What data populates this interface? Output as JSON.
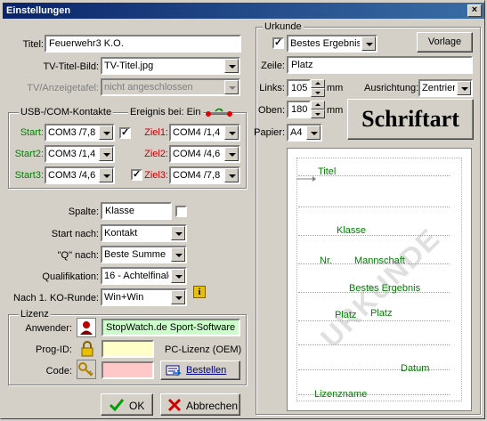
{
  "window": {
    "title": "Einstellungen",
    "close": "×"
  },
  "left": {
    "titel_label": "Titel:",
    "titel_value": "Feuerwehr3 K.O.",
    "tvbild_label": "TV-Titel-Bild:",
    "tvbild_value": "TV-Titel.jpg",
    "tvanz_label": "TV/Anzeigetafel:",
    "tvanz_value": "nicht angeschlossen",
    "usb_group": "USB-/COM-Kontakte",
    "ereignis_label": "Ereignis bei: Ein",
    "start_label": "Start:",
    "start_value": "COM3 /7,8",
    "start2_label": "Start2:",
    "start2_value": "COM3 /1,4",
    "start3_label": "Start3:",
    "start3_value": "COM3 /4,6",
    "ziel1_label": "Ziel1:",
    "ziel1_value": "COM4 /1,4",
    "ziel2_label": "Ziel2:",
    "ziel2_value": "COM4 /4,6",
    "ziel3_label": "Ziel3:",
    "ziel3_value": "COM4 /7,8",
    "check_mark": "✓",
    "spalte_label": "Spalte:",
    "spalte_value": "Klasse",
    "startnach_label": "Start nach:",
    "startnach_value": "Kontakt",
    "qnach_label": "\"Q\" nach:",
    "qnach_value": "Beste Summe",
    "quali_label": "Qualifikation:",
    "quali_value": "16 - Achtelfinale",
    "ko_label": "Nach 1. KO-Runde:",
    "ko_value": "Win+Win",
    "info_icon_text": "i",
    "lizenz_group": "Lizenz",
    "anwender_label": "Anwender:",
    "anwender_value": "StopWatch.de Sport-Software",
    "progid_label": "Prog-ID:",
    "progid_value": "",
    "pclizenz": "PC-Lizenz (OEM)",
    "code_label": "Code:",
    "code_value": "",
    "bestellen": "Bestellen",
    "ok": "OK",
    "abbrechen": "Abbrechen",
    "ok_icon": "checkmark-icon",
    "cancel_icon": "cross-icon"
  },
  "urkunde": {
    "group": "Urkunde",
    "bestes_value": "Bestes Ergebnis",
    "vorlage": "Vorlage",
    "zeile_label": "Zeile:",
    "zeile_value": "Platz",
    "links_label": "Links:",
    "links_value": "105",
    "mm1": "mm",
    "ausrichtung_label": "Ausrichtung:",
    "ausrichtung_value": "Zentriert",
    "oben_label": "Oben:",
    "oben_value": "180",
    "mm2": "mm",
    "papier_label": "Papier:",
    "papier_value": "A4",
    "schriftart": "Schriftart",
    "preview": {
      "watermark": "URKUNDE",
      "titel": "Titel",
      "klasse": "Klasse",
      "nr": "Nr.",
      "mannschaft": "Mannschaft",
      "bestes": "Bestes Ergebnis",
      "platz1": "Platz",
      "platz2": "Platz",
      "datum": "Datum",
      "lizenzname": "Lizenzname"
    }
  },
  "colors": {
    "green_label": "#008000",
    "red_label": "#c00000",
    "titlebar": "#0a246a"
  }
}
